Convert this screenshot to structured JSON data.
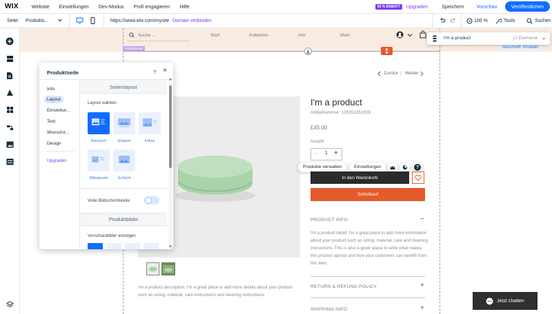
{
  "topbar": {
    "logo": "WIX",
    "menu": [
      "Website",
      "Einstellungen",
      "Dev-Modus",
      "Profi engagieren",
      "Hilfe"
    ],
    "discount_badge": "50 % RABATT",
    "upgrade": "Upgraden",
    "save": "Speichern",
    "preview": "Vorschau",
    "publish": "Veröffentlichen"
  },
  "toolbar": {
    "page_label": "Seite:",
    "page_value": "Produkts...",
    "url": "https://www.wix.com/mysite",
    "connect_domain": "Domain verbinden",
    "zoom": "100 %",
    "tools": "Tools",
    "search": "Suchen"
  },
  "site": {
    "search_placeholder": "Suche ...",
    "nav": [
      "Start",
      "Kollektion",
      "Info",
      "Mehr"
    ],
    "page_strip_label": "Produktseite",
    "section_label": "Abschnitt: Produkt",
    "prev": "Zurück",
    "separator": "|",
    "next": "Weiter"
  },
  "layer_dropdown": {
    "label": "I'm a product",
    "count": "12 Elemente"
  },
  "panel": {
    "title": "Produktseite",
    "help": "?",
    "close": "×",
    "tabs": [
      "Info",
      "Layout",
      "Einstellun...",
      "Text",
      "Wunschz...",
      "Design",
      "Upgraden"
    ],
    "active_tab": "Layout",
    "section_layout": "Seitenlayout",
    "choose_layout": "Layout wählen:",
    "layouts": [
      "Klassisch",
      "Elegant",
      "Fokus",
      "Mittelpunkt",
      "Schlicht"
    ],
    "fullwidth_label": "Volle Bildschirmbreite",
    "fullwidth_on": false,
    "section_images": "Produktbilder",
    "thumbs_label": "Vorschaubilder anzeigen"
  },
  "product": {
    "title": "I'm a product",
    "sku": "Artikelnummer: 126351351935",
    "price": "£45.00",
    "qty_label": "Anzahl",
    "qty": "1",
    "qty_minus": "−",
    "qty_plus": "+",
    "add_to_cart": "In den Warenkorb",
    "buy_now": "Sofortkauf",
    "floating_manage": "Produkte verwalten",
    "floating_settings": "Einstellungen",
    "floating_help": "?",
    "info_title": "PRODUCT INFO",
    "info_toggle": "−",
    "info_text": "I'm a product detail. I'm a great place to add more information about your product such as sizing, material, care and cleaning instructions. This is also a great space to write what makes this product special and how your customers can benefit from this item.",
    "return_title": "RETURN & REFUND POLICY",
    "shipping_title": "SHIPPING INFO",
    "plus": "+",
    "description": "I'm a product description. I'm a great place to add more details about your product such as sizing, material, care instructions and cleaning instructions."
  },
  "chat": {
    "label": "Jetzt chatten"
  },
  "colors": {
    "accent": "#116dff",
    "purple": "#7a3df2",
    "orange": "#e55a2b",
    "header_bg": "#f9ece2",
    "product_green": "#a9d3a9"
  }
}
